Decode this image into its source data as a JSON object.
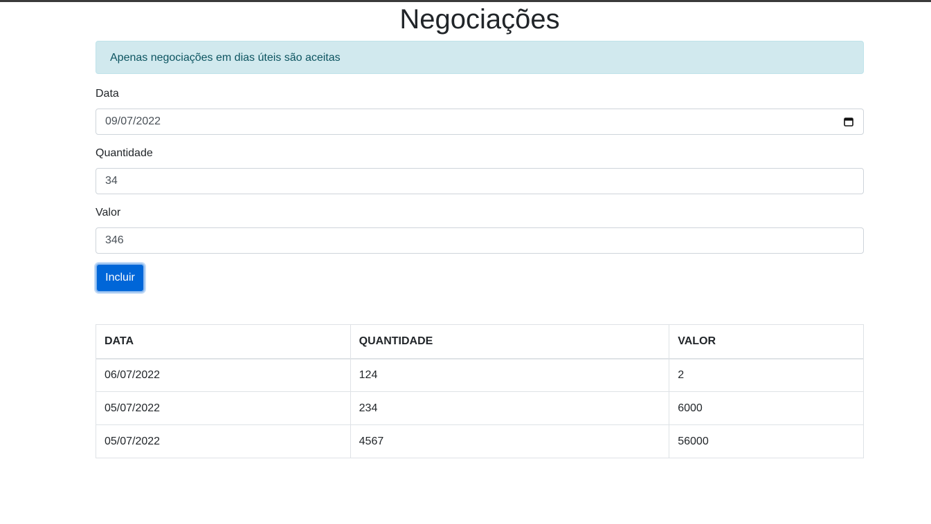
{
  "page": {
    "title": "Negociações"
  },
  "alert": {
    "text": "Apenas negociações em dias úteis são aceitas"
  },
  "form": {
    "data": {
      "label": "Data",
      "value": "09/07/2022"
    },
    "quantidade": {
      "label": "Quantidade",
      "value": "34"
    },
    "valor": {
      "label": "Valor",
      "value": "346"
    },
    "submit_label": "Incluir"
  },
  "table": {
    "headers": [
      "DATA",
      "QUANTIDADE",
      "VALOR"
    ],
    "rows": [
      [
        "06/07/2022",
        "124",
        "2"
      ],
      [
        "05/07/2022",
        "234",
        "6000"
      ],
      [
        "05/07/2022",
        "4567",
        "56000"
      ]
    ]
  },
  "icons": {
    "calendar": "calendar-icon"
  },
  "colors": {
    "primary": "#0066d8",
    "alert_bg": "#d1e9ee",
    "alert_text": "#0c5460"
  }
}
